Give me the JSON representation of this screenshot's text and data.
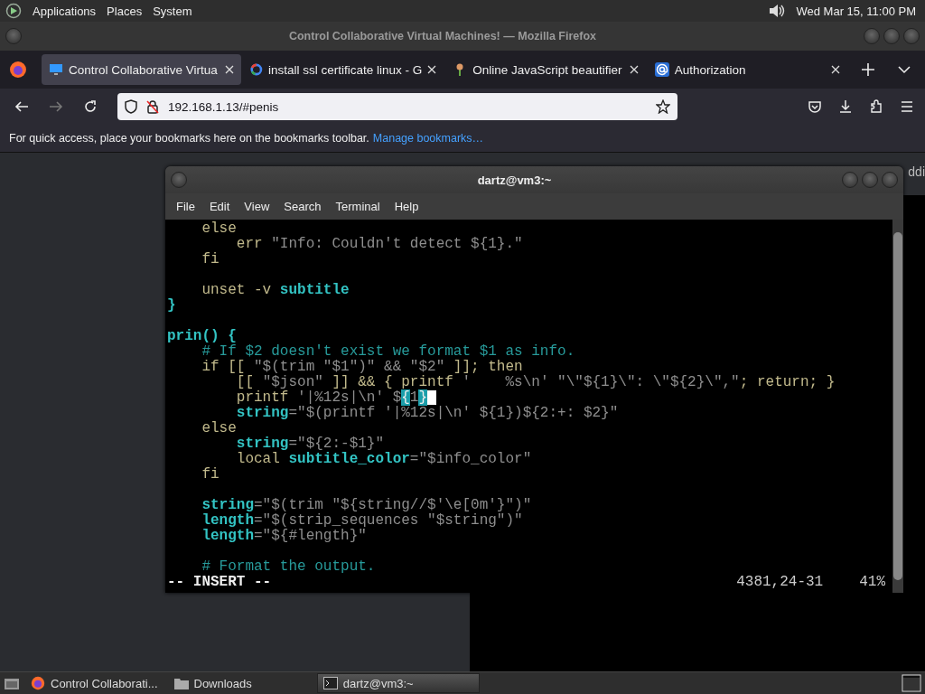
{
  "top_panel": {
    "menus": [
      "Applications",
      "Places",
      "System"
    ],
    "clock": "Wed Mar 15, 11:00 PM"
  },
  "browser": {
    "title": "Control Collaborative Virtual Machines! — Mozilla Firefox",
    "tabs": [
      {
        "label": "Control Collaborative Virtua",
        "kind": "monitor",
        "selected": true
      },
      {
        "label": "install ssl certificate linux - G",
        "kind": "ring",
        "selected": false
      },
      {
        "label": "Online JavaScript beautifier",
        "kind": "plant",
        "selected": false
      },
      {
        "label": "Authorization",
        "kind": "at",
        "selected": false
      }
    ],
    "url": "192.168.1.13/#penis",
    "bookmarks_hint": "For quick access, place your bookmarks here on the bookmarks toolbar.",
    "bookmarks_link": "Manage bookmarks…",
    "page_fragment": "ddi"
  },
  "terminal": {
    "title": "dartz@vm3:~",
    "menus": [
      "File",
      "Edit",
      "View",
      "Search",
      "Terminal",
      "Help"
    ],
    "lines": [
      {
        "kind": "code",
        "segments": [
          {
            "kind": "kw",
            "t": "    else"
          }
        ]
      },
      {
        "kind": "code",
        "segments": [
          {
            "kind": "kw",
            "t": "        err "
          },
          {
            "kind": "str",
            "t": "\"Info: Couldn't detect ${1}.\""
          }
        ]
      },
      {
        "kind": "code",
        "segments": [
          {
            "kind": "kw",
            "t": "    fi"
          }
        ]
      },
      {
        "kind": "blank"
      },
      {
        "kind": "code",
        "segments": [
          {
            "kind": "kw",
            "t": "    unset -v "
          },
          {
            "kind": "var",
            "t": "subtitle"
          }
        ]
      },
      {
        "kind": "code",
        "segments": [
          {
            "kind": "func",
            "t": "}"
          }
        ]
      },
      {
        "kind": "blank"
      },
      {
        "kind": "code",
        "segments": [
          {
            "kind": "func",
            "t": "prin() {"
          }
        ]
      },
      {
        "kind": "code",
        "segments": [
          {
            "kind": "comment",
            "t": "    # If $2 doesn't exist we format $1 as info."
          }
        ]
      },
      {
        "kind": "code",
        "segments": [
          {
            "kind": "kw",
            "t": "    if [[ "
          },
          {
            "kind": "str",
            "t": "\"$(trim \"$1\")\" && \"$2\""
          },
          {
            "kind": "kw",
            "t": " ]]; then"
          }
        ]
      },
      {
        "kind": "code",
        "segments": [
          {
            "kind": "kw",
            "t": "        [[ "
          },
          {
            "kind": "str",
            "t": "\"$json\""
          },
          {
            "kind": "kw",
            "t": " ]] && { printf "
          },
          {
            "kind": "str",
            "t": "'    %s\\n' \"\\\"${1}\\\": \\\"${2}\\\",\""
          },
          {
            "kind": "kw",
            "t": "; return; }"
          }
        ]
      },
      {
        "kind": "code",
        "segments": [
          {
            "kind": "kw",
            "t": "        printf "
          },
          {
            "kind": "str",
            "t": "'|%12s|\\n' $"
          },
          {
            "kind": "match",
            "t": "{"
          },
          {
            "kind": "str",
            "t": "1"
          },
          {
            "kind": "match",
            "t": "}"
          },
          {
            "kind": "cursor"
          }
        ]
      },
      {
        "kind": "code",
        "segments": [
          {
            "kind": "var",
            "t": "        string"
          },
          {
            "kind": "str",
            "t": "=\"$(printf '|%12s|\\n' ${1})${2:+: $2}\""
          }
        ]
      },
      {
        "kind": "code",
        "segments": [
          {
            "kind": "kw",
            "t": "    else"
          }
        ]
      },
      {
        "kind": "code",
        "segments": [
          {
            "kind": "var",
            "t": "        string"
          },
          {
            "kind": "str",
            "t": "=\"${2:-$1}\""
          }
        ]
      },
      {
        "kind": "code",
        "segments": [
          {
            "kind": "kw",
            "t": "        local "
          },
          {
            "kind": "var",
            "t": "subtitle_color"
          },
          {
            "kind": "str",
            "t": "=\"$info_color\""
          }
        ]
      },
      {
        "kind": "code",
        "segments": [
          {
            "kind": "kw",
            "t": "    fi"
          }
        ]
      },
      {
        "kind": "blank"
      },
      {
        "kind": "code",
        "segments": [
          {
            "kind": "var",
            "t": "    string"
          },
          {
            "kind": "str",
            "t": "=\"$(trim \"${string//$'\\e[0m'}\")\""
          }
        ]
      },
      {
        "kind": "code",
        "segments": [
          {
            "kind": "var",
            "t": "    length"
          },
          {
            "kind": "str",
            "t": "=\"$(strip_sequences \"$string\")\""
          }
        ]
      },
      {
        "kind": "code",
        "segments": [
          {
            "kind": "var",
            "t": "    length"
          },
          {
            "kind": "str",
            "t": "=\"${#length}\""
          }
        ]
      },
      {
        "kind": "blank"
      },
      {
        "kind": "code",
        "segments": [
          {
            "kind": "comment",
            "t": "    # Format the output."
          }
        ]
      }
    ],
    "mode": "-- INSERT --",
    "position": "4381,24-31",
    "percent": "41%"
  },
  "taskbar": {
    "items": [
      {
        "label": "Control Collaborati...",
        "kind": "firefox",
        "selected": false
      },
      {
        "label": "Downloads",
        "kind": "folder",
        "selected": false
      },
      {
        "label": "dartz@vm3:~",
        "kind": "terminal",
        "selected": true
      }
    ]
  }
}
